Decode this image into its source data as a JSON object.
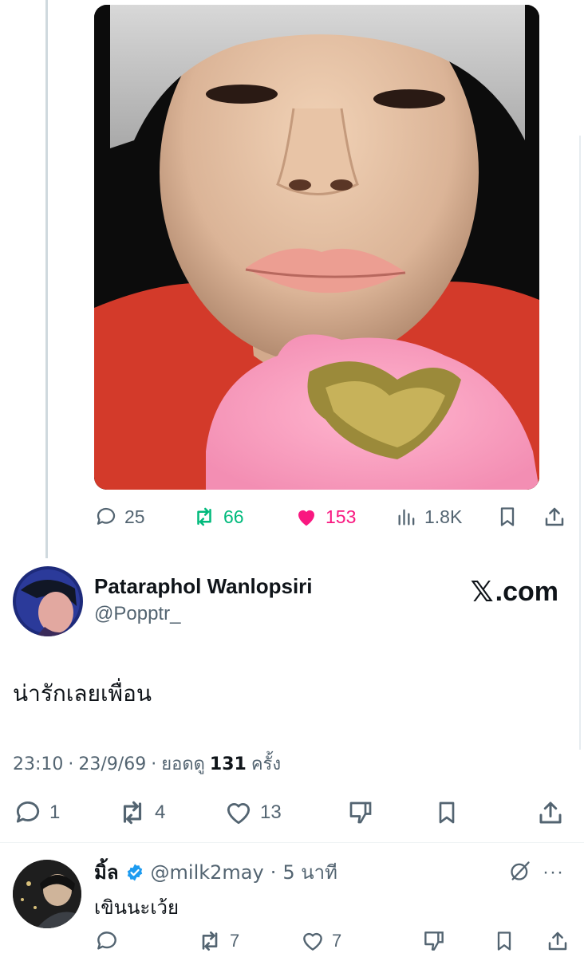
{
  "parent_tweet": {
    "metrics": {
      "replies": "25",
      "retweets": "66",
      "likes": "153",
      "views": "1.8K"
    },
    "colors": {
      "retweeted": "#00ba7c",
      "liked": "#f91880"
    }
  },
  "main_tweet": {
    "display_name": "Pataraphol Wanlopsiri",
    "handle": "@Popptr_",
    "source_mark": "𝕏",
    "source_text": ".com",
    "text": "น่ารักเลยเพื่อน",
    "time": "23:10",
    "date": "23/9/69",
    "views_label_prefix": "ยอดดู",
    "views": "131",
    "views_label_suffix": "ครั้ง",
    "sep": "·",
    "metrics": {
      "replies": "1",
      "retweets": "4",
      "likes": "13"
    }
  },
  "reply": {
    "display_name": "มิ้ล",
    "handle": "@milk2may",
    "sep": "·",
    "time_ago": "5 นาที",
    "text": "เขินนะเว้ย",
    "more": "···",
    "verified_color": "#1d9bf0",
    "metrics": {
      "retweets": "7",
      "likes": "7"
    }
  }
}
